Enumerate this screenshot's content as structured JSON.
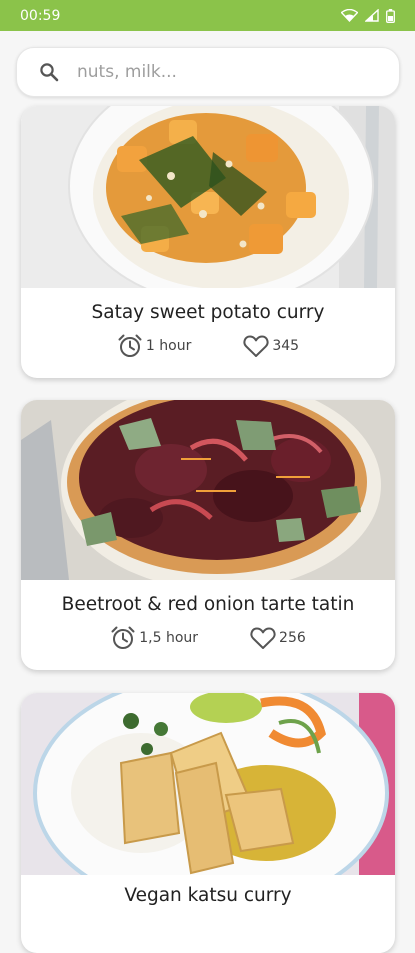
{
  "status_bar": {
    "time": "00:59"
  },
  "search": {
    "placeholder": "nuts, milk...",
    "value": ""
  },
  "recipes": [
    {
      "title": "Satay sweet potato curry",
      "time": "1 hour",
      "likes": "345"
    },
    {
      "title": "Beetroot & red onion tarte tatin",
      "time": "1,5 hour",
      "likes": "256"
    },
    {
      "title": "Vegan katsu curry"
    }
  ],
  "colors": {
    "status_bar": "#8bc34a",
    "background": "#f6f6f6",
    "card": "#ffffff"
  }
}
